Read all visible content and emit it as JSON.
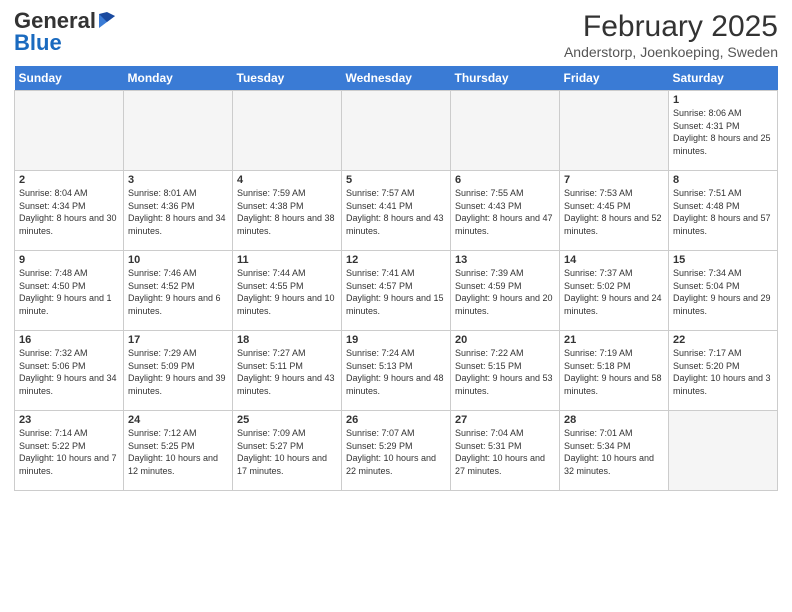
{
  "logo": {
    "general": "General",
    "blue": "Blue"
  },
  "header": {
    "month": "February 2025",
    "location": "Anderstorp, Joenkoeping, Sweden"
  },
  "weekdays": [
    "Sunday",
    "Monday",
    "Tuesday",
    "Wednesday",
    "Thursday",
    "Friday",
    "Saturday"
  ],
  "weeks": [
    [
      {
        "day": "",
        "info": ""
      },
      {
        "day": "",
        "info": ""
      },
      {
        "day": "",
        "info": ""
      },
      {
        "day": "",
        "info": ""
      },
      {
        "day": "",
        "info": ""
      },
      {
        "day": "",
        "info": ""
      },
      {
        "day": "1",
        "info": "Sunrise: 8:06 AM\nSunset: 4:31 PM\nDaylight: 8 hours and 25 minutes."
      }
    ],
    [
      {
        "day": "2",
        "info": "Sunrise: 8:04 AM\nSunset: 4:34 PM\nDaylight: 8 hours and 30 minutes."
      },
      {
        "day": "3",
        "info": "Sunrise: 8:01 AM\nSunset: 4:36 PM\nDaylight: 8 hours and 34 minutes."
      },
      {
        "day": "4",
        "info": "Sunrise: 7:59 AM\nSunset: 4:38 PM\nDaylight: 8 hours and 38 minutes."
      },
      {
        "day": "5",
        "info": "Sunrise: 7:57 AM\nSunset: 4:41 PM\nDaylight: 8 hours and 43 minutes."
      },
      {
        "day": "6",
        "info": "Sunrise: 7:55 AM\nSunset: 4:43 PM\nDaylight: 8 hours and 47 minutes."
      },
      {
        "day": "7",
        "info": "Sunrise: 7:53 AM\nSunset: 4:45 PM\nDaylight: 8 hours and 52 minutes."
      },
      {
        "day": "8",
        "info": "Sunrise: 7:51 AM\nSunset: 4:48 PM\nDaylight: 8 hours and 57 minutes."
      }
    ],
    [
      {
        "day": "9",
        "info": "Sunrise: 7:48 AM\nSunset: 4:50 PM\nDaylight: 9 hours and 1 minute."
      },
      {
        "day": "10",
        "info": "Sunrise: 7:46 AM\nSunset: 4:52 PM\nDaylight: 9 hours and 6 minutes."
      },
      {
        "day": "11",
        "info": "Sunrise: 7:44 AM\nSunset: 4:55 PM\nDaylight: 9 hours and 10 minutes."
      },
      {
        "day": "12",
        "info": "Sunrise: 7:41 AM\nSunset: 4:57 PM\nDaylight: 9 hours and 15 minutes."
      },
      {
        "day": "13",
        "info": "Sunrise: 7:39 AM\nSunset: 4:59 PM\nDaylight: 9 hours and 20 minutes."
      },
      {
        "day": "14",
        "info": "Sunrise: 7:37 AM\nSunset: 5:02 PM\nDaylight: 9 hours and 24 minutes."
      },
      {
        "day": "15",
        "info": "Sunrise: 7:34 AM\nSunset: 5:04 PM\nDaylight: 9 hours and 29 minutes."
      }
    ],
    [
      {
        "day": "16",
        "info": "Sunrise: 7:32 AM\nSunset: 5:06 PM\nDaylight: 9 hours and 34 minutes."
      },
      {
        "day": "17",
        "info": "Sunrise: 7:29 AM\nSunset: 5:09 PM\nDaylight: 9 hours and 39 minutes."
      },
      {
        "day": "18",
        "info": "Sunrise: 7:27 AM\nSunset: 5:11 PM\nDaylight: 9 hours and 43 minutes."
      },
      {
        "day": "19",
        "info": "Sunrise: 7:24 AM\nSunset: 5:13 PM\nDaylight: 9 hours and 48 minutes."
      },
      {
        "day": "20",
        "info": "Sunrise: 7:22 AM\nSunset: 5:15 PM\nDaylight: 9 hours and 53 minutes."
      },
      {
        "day": "21",
        "info": "Sunrise: 7:19 AM\nSunset: 5:18 PM\nDaylight: 9 hours and 58 minutes."
      },
      {
        "day": "22",
        "info": "Sunrise: 7:17 AM\nSunset: 5:20 PM\nDaylight: 10 hours and 3 minutes."
      }
    ],
    [
      {
        "day": "23",
        "info": "Sunrise: 7:14 AM\nSunset: 5:22 PM\nDaylight: 10 hours and 7 minutes."
      },
      {
        "day": "24",
        "info": "Sunrise: 7:12 AM\nSunset: 5:25 PM\nDaylight: 10 hours and 12 minutes."
      },
      {
        "day": "25",
        "info": "Sunrise: 7:09 AM\nSunset: 5:27 PM\nDaylight: 10 hours and 17 minutes."
      },
      {
        "day": "26",
        "info": "Sunrise: 7:07 AM\nSunset: 5:29 PM\nDaylight: 10 hours and 22 minutes."
      },
      {
        "day": "27",
        "info": "Sunrise: 7:04 AM\nSunset: 5:31 PM\nDaylight: 10 hours and 27 minutes."
      },
      {
        "day": "28",
        "info": "Sunrise: 7:01 AM\nSunset: 5:34 PM\nDaylight: 10 hours and 32 minutes."
      },
      {
        "day": "",
        "info": ""
      }
    ]
  ]
}
